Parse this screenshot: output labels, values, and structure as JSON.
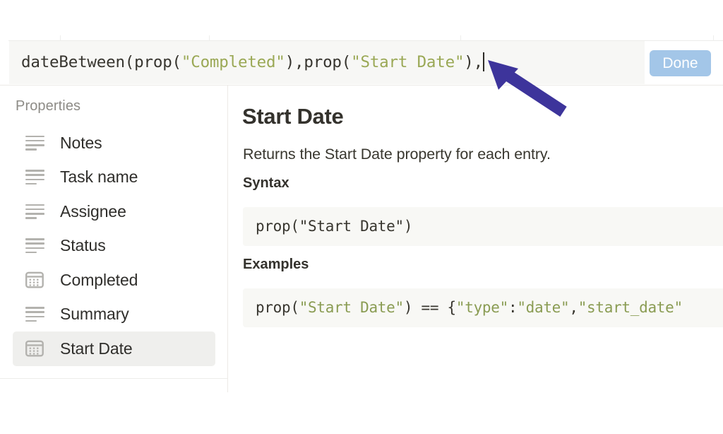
{
  "formula_bar": {
    "name": "formula-editor",
    "formula_segments": [
      {
        "text": "dateBetween(prop(",
        "type": "plain"
      },
      {
        "text": "\"Completed\"",
        "type": "string"
      },
      {
        "text": "),prop(",
        "type": "plain"
      },
      {
        "text": "\"Start Date\"",
        "type": "string"
      },
      {
        "text": "),",
        "type": "plain"
      }
    ],
    "formula_full": "dateBetween(prop(\"Completed\"),prop(\"Start Date\"),",
    "caret_visible": true,
    "done_label": "Done",
    "done_color": "#a3c6e8",
    "input_background": "#f7f7f5",
    "string_color": "#9aa855"
  },
  "sidebar": {
    "heading": "Properties",
    "selected_index": 6,
    "items": [
      {
        "label": "Notes",
        "icon": "text-icon"
      },
      {
        "label": "Task name",
        "icon": "text-icon"
      },
      {
        "label": "Assignee",
        "icon": "text-icon"
      },
      {
        "label": "Status",
        "icon": "text-icon"
      },
      {
        "label": "Completed",
        "icon": "calendar-icon"
      },
      {
        "label": "Summary",
        "icon": "text-icon"
      },
      {
        "label": "Start Date",
        "icon": "calendar-icon"
      }
    ],
    "selected_background": "#efefed"
  },
  "content": {
    "title": "Start Date",
    "description": "Returns the Start Date property for each entry.",
    "syntax_heading": "Syntax",
    "syntax_code_segments": [
      {
        "text": "prop(\"Start Date\")",
        "type": "plain"
      }
    ],
    "syntax_code_full": "prop(\"Start Date\")",
    "examples_heading": "Examples",
    "examples_code_segments": [
      {
        "text": "prop(",
        "type": "plain"
      },
      {
        "text": "\"Start Date\"",
        "type": "string"
      },
      {
        "text": ") == {",
        "type": "plain"
      },
      {
        "text": "\"type\"",
        "type": "string"
      },
      {
        "text": ":",
        "type": "plain"
      },
      {
        "text": "\"date\"",
        "type": "string"
      },
      {
        "text": ",",
        "type": "plain"
      },
      {
        "text": "\"start_date\"",
        "type": "string"
      }
    ],
    "examples_code_full": "prop(\"Start Date\") == {\"type\":\"date\",\"start_date\"",
    "code_background": "#f8f8f5",
    "string_color": "#8a9c53"
  },
  "annotation": {
    "arrow_color": "#3d349b",
    "points_to": "formula-caret"
  }
}
